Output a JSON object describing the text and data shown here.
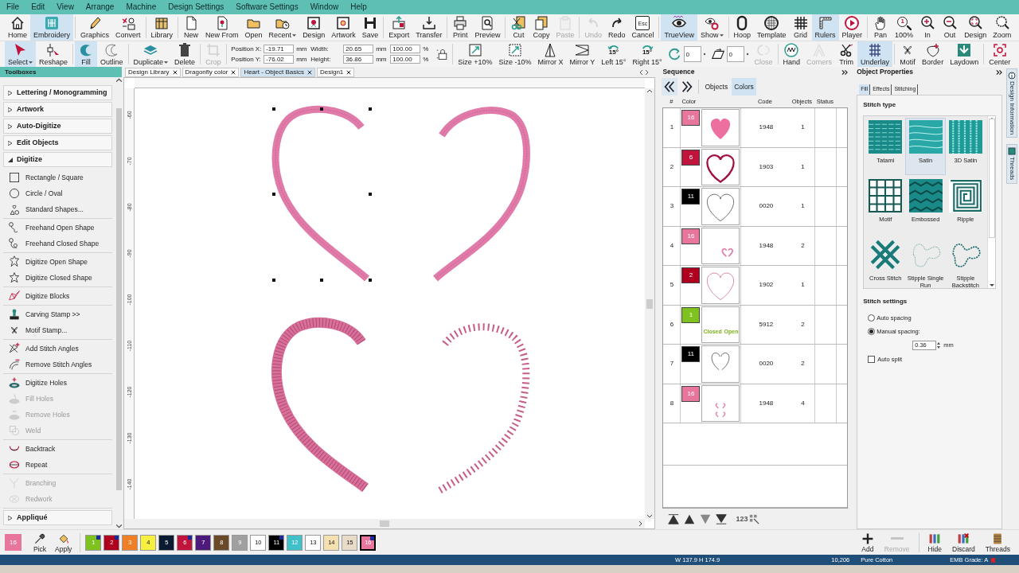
{
  "menu": [
    "File",
    "Edit",
    "View",
    "Arrange",
    "Machine",
    "Design Settings",
    "Software Settings",
    "Window",
    "Help"
  ],
  "ribbon": [
    {
      "label": "Home",
      "selected": false,
      "disabled": false
    },
    {
      "label": "Embroidery",
      "selected": true,
      "disabled": false,
      "group_end": true
    },
    {
      "label": "Graphics",
      "selected": false,
      "disabled": false
    },
    {
      "label": "Convert",
      "selected": false,
      "disabled": false,
      "group_end": true
    },
    {
      "label": "Library",
      "selected": false,
      "disabled": false,
      "group_end": true
    },
    {
      "label": "New",
      "selected": false,
      "disabled": false
    },
    {
      "label": "New From",
      "selected": false,
      "disabled": false
    },
    {
      "label": "Open",
      "selected": false,
      "disabled": false
    },
    {
      "label": "Recent",
      "selected": false,
      "disabled": false,
      "dropdown": true
    },
    {
      "label": "Design",
      "selected": false,
      "disabled": false
    },
    {
      "label": "Artwork",
      "selected": false,
      "disabled": false
    },
    {
      "label": "Save",
      "selected": false,
      "disabled": false,
      "group_end": true
    },
    {
      "label": "Export",
      "selected": false,
      "disabled": false
    },
    {
      "label": "Transfer",
      "selected": false,
      "disabled": false,
      "group_end": true
    },
    {
      "label": "Print",
      "selected": false,
      "disabled": false
    },
    {
      "label": "Preview",
      "selected": false,
      "disabled": false,
      "group_end": true
    },
    {
      "label": "Cut",
      "selected": false,
      "disabled": false
    },
    {
      "label": "Copy",
      "selected": false,
      "disabled": false
    },
    {
      "label": "Paste",
      "selected": false,
      "disabled": true,
      "group_end": true
    },
    {
      "label": "Undo",
      "selected": false,
      "disabled": true
    },
    {
      "label": "Redo",
      "selected": false,
      "disabled": false
    },
    {
      "label": "Cancel",
      "selected": false,
      "disabled": false,
      "icon_text": "Esc",
      "group_end": true
    },
    {
      "label": "TrueView",
      "selected": true,
      "disabled": false
    },
    {
      "label": "Show",
      "selected": false,
      "disabled": false,
      "dropdown": true,
      "group_end": true
    },
    {
      "label": "Hoop",
      "selected": false,
      "disabled": false
    },
    {
      "label": "Template",
      "selected": false,
      "disabled": false
    },
    {
      "label": "Grid",
      "selected": false,
      "disabled": false
    },
    {
      "label": "Rulers",
      "selected": true,
      "disabled": false
    },
    {
      "label": "Player",
      "selected": false,
      "disabled": false,
      "group_end": true
    },
    {
      "label": "Pan",
      "selected": false,
      "disabled": false
    },
    {
      "label": "100%",
      "selected": false,
      "disabled": false,
      "icon_text": "1"
    },
    {
      "label": "In",
      "selected": false,
      "disabled": false
    },
    {
      "label": "Out",
      "selected": false,
      "disabled": false
    },
    {
      "label": "Design",
      "selected": false,
      "disabled": false
    },
    {
      "label": "Zoom",
      "selected": false,
      "disabled": false
    }
  ],
  "toolbar": [
    {
      "kind": "button",
      "label": "Select",
      "selected": true,
      "disabled": false,
      "dropdown": true
    },
    {
      "kind": "button",
      "label": "Reshape",
      "selected": false,
      "disabled": false,
      "group_end": true
    },
    {
      "kind": "button",
      "label": "Fill",
      "selected": true,
      "disabled": false
    },
    {
      "kind": "button",
      "label": "Outline",
      "selected": false,
      "disabled": false,
      "group_end": true
    },
    {
      "kind": "button",
      "label": "Duplicate",
      "selected": false,
      "disabled": false,
      "dropdown": true
    },
    {
      "kind": "button",
      "label": "Delete",
      "selected": false,
      "disabled": false,
      "group_end": true
    },
    {
      "kind": "button",
      "label": "Crop",
      "selected": false,
      "disabled": true,
      "group_end": true
    },
    {
      "kind": "fields",
      "fields": [
        {
          "label": "Position X:",
          "value": "-19.71",
          "unit": "mm"
        },
        {
          "label": "Position Y:",
          "value": "-76.02",
          "unit": "mm"
        }
      ]
    },
    {
      "kind": "fields",
      "fields": [
        {
          "label": "Width:",
          "value": "20.65",
          "unit": "mm"
        },
        {
          "label": "Height:",
          "value": "36.86",
          "unit": "mm"
        }
      ]
    },
    {
      "kind": "fields",
      "fields": [
        {
          "value": "100.00",
          "unit": "%"
        },
        {
          "value": "100.00",
          "unit": "%"
        }
      ]
    },
    {
      "kind": "lock",
      "group_end": true
    },
    {
      "kind": "button",
      "label": "Size +10%",
      "selected": false,
      "disabled": false
    },
    {
      "kind": "button",
      "label": "Size -10%",
      "selected": false,
      "disabled": false
    },
    {
      "kind": "button",
      "label": "Mirror X",
      "selected": false,
      "disabled": false
    },
    {
      "kind": "button",
      "label": "Mirror Y",
      "selected": false,
      "disabled": false
    },
    {
      "kind": "button",
      "label": "Left 15°",
      "selected": false,
      "disabled": false,
      "icon_text": "15°"
    },
    {
      "kind": "button",
      "label": "Right 15°",
      "selected": false,
      "disabled": false,
      "icon_text": "15°"
    },
    {
      "kind": "spin",
      "value": "0"
    },
    {
      "kind": "spin",
      "value": "0"
    },
    {
      "kind": "button",
      "label": "Close",
      "selected": false,
      "disabled": true,
      "group_end": true
    },
    {
      "kind": "button",
      "label": "Hand",
      "selected": false,
      "disabled": false
    },
    {
      "kind": "button",
      "label": "Corners",
      "selected": false,
      "disabled": true
    },
    {
      "kind": "button",
      "label": "Trim",
      "selected": false,
      "disabled": false
    },
    {
      "kind": "button",
      "label": "Underlay",
      "selected": true,
      "disabled": false,
      "group_end": true
    },
    {
      "kind": "button",
      "label": "Motif",
      "selected": false,
      "disabled": false
    },
    {
      "kind": "button",
      "label": "Border",
      "selected": false,
      "disabled": false
    },
    {
      "kind": "button",
      "label": "Laydown",
      "selected": false,
      "disabled": false,
      "group_end": true
    },
    {
      "kind": "button",
      "label": "Center",
      "selected": false,
      "disabled": false
    }
  ],
  "toolboxes": {
    "title": "Toolboxes",
    "sections": [
      {
        "label": "Lettering / Monogramming",
        "expanded": false
      },
      {
        "label": "Artwork",
        "expanded": false
      },
      {
        "label": "Auto-Digitize",
        "expanded": false
      },
      {
        "label": "Edit Objects",
        "expanded": false
      },
      {
        "label": "Digitize",
        "expanded": true,
        "groups": [
          [
            {
              "label": "Rectangle / Square",
              "disabled": false
            },
            {
              "label": "Circle / Oval",
              "disabled": false
            },
            {
              "label": "Standard Shapes...",
              "disabled": false
            }
          ],
          [
            {
              "label": "Freehand Open Shape",
              "disabled": false
            },
            {
              "label": "Freehand Closed Shape",
              "disabled": false
            }
          ],
          [
            {
              "label": "Digitize Open Shape",
              "disabled": false
            },
            {
              "label": "Digitize Closed Shape",
              "disabled": false
            }
          ],
          [
            {
              "label": "Digitize Blocks",
              "disabled": false
            }
          ],
          [
            {
              "label": "Carving Stamp >>",
              "disabled": false
            },
            {
              "label": "Motif Stamp...",
              "disabled": false
            }
          ],
          [
            {
              "label": "Add Stitch Angles",
              "disabled": false
            },
            {
              "label": "Remove Stitch Angles",
              "disabled": false
            }
          ],
          [
            {
              "label": "Digitize Holes",
              "disabled": false
            },
            {
              "label": "Fill Holes",
              "disabled": true
            },
            {
              "label": "Remove Holes",
              "disabled": true
            },
            {
              "label": "Weld",
              "disabled": true
            }
          ],
          [
            {
              "label": "Backtrack",
              "disabled": false
            },
            {
              "label": "Repeat",
              "disabled": false
            }
          ],
          [
            {
              "label": "Branching",
              "disabled": true
            },
            {
              "label": "Redwork",
              "disabled": true
            }
          ]
        ]
      },
      {
        "label": "Appliqué",
        "expanded": false
      }
    ]
  },
  "doc_tabs": [
    {
      "label": "Design Library",
      "selected": false
    },
    {
      "label": "Dragonfly color",
      "selected": false
    },
    {
      "label": "Heart - Object Basics",
      "selected": true
    },
    {
      "label": "Design1",
      "selected": false
    }
  ],
  "canvas": {
    "ruler_labels": [
      "-60",
      "-70",
      "-80",
      "-90",
      "-100",
      "-110",
      "-120",
      "-130",
      "-140"
    ]
  },
  "sequence": {
    "title": "Sequence",
    "tabs": [
      {
        "label": "Objects",
        "selected": false
      },
      {
        "label": "Colors",
        "selected": true
      }
    ],
    "columns": [
      "#",
      "Color",
      "Code",
      "Objects",
      "Status"
    ],
    "rows": [
      {
        "number": "1",
        "swatch": "16",
        "color": "#e8759c",
        "code": "1948",
        "objects": "1"
      },
      {
        "number": "2",
        "swatch": "6",
        "color": "#c0143c",
        "code": "1903",
        "objects": "1"
      },
      {
        "number": "3",
        "swatch": "11",
        "color": "#000000",
        "code": "0020",
        "objects": "1"
      },
      {
        "number": "4",
        "swatch": "16",
        "color": "#e8759c",
        "code": "1948",
        "objects": "2"
      },
      {
        "number": "5",
        "swatch": "2",
        "color": "#b00020",
        "code": "1902",
        "objects": "1"
      },
      {
        "number": "6",
        "swatch": "1",
        "color": "#7dc21e",
        "code": "5912",
        "objects": "2",
        "thumb_labels": [
          "Closed",
          "Open"
        ]
      },
      {
        "number": "7",
        "swatch": "11",
        "color": "#000000",
        "code": "0020",
        "objects": "2"
      },
      {
        "number": "8",
        "swatch": "16",
        "color": "#e8759c",
        "code": "1948",
        "objects": "4"
      }
    ],
    "order_label": "123"
  },
  "properties": {
    "title": "Object Properties",
    "tabs": [
      {
        "label": "Fill",
        "selected": true
      },
      {
        "label": "Effects",
        "selected": false
      },
      {
        "label": "Stitching",
        "selected": false
      }
    ],
    "stitch_type_title": "Stitch type",
    "stitch_types": [
      {
        "label": "Tatami",
        "selected": false
      },
      {
        "label": "Satin",
        "selected": true
      },
      {
        "label": "3D Satin",
        "selected": false
      },
      {
        "label": "Motif",
        "selected": false
      },
      {
        "label": "Embossed",
        "selected": false
      },
      {
        "label": "Ripple",
        "selected": false
      },
      {
        "label": "Cross Stitch",
        "selected": false
      },
      {
        "label": "Stipple Single Run",
        "selected": false
      },
      {
        "label": "Stipple Backstitch",
        "selected": false
      }
    ],
    "settings_title": "Stitch settings",
    "spacing": [
      {
        "label": "Auto spacing",
        "selected": false
      },
      {
        "label": "Manual spacing:",
        "selected": true
      }
    ],
    "spacing_value": "0.36",
    "spacing_unit": "mm",
    "auto_split": {
      "label": "Auto split",
      "checked": false
    }
  },
  "side_tabs": [
    "Design Information",
    "Threads"
  ],
  "palette": {
    "current": {
      "number": "16",
      "color": "#e8759c"
    },
    "tools": [
      "Pick",
      "Apply"
    ],
    "swatches": [
      {
        "number": "1",
        "color": "#7dc21e",
        "used": true,
        "selected": false
      },
      {
        "number": "2",
        "color": "#b00020",
        "used": true,
        "selected": false
      },
      {
        "number": "3",
        "color": "#f08028",
        "used": false,
        "selected": false
      },
      {
        "number": "4",
        "color": "#f8f040",
        "used": false,
        "selected": false
      },
      {
        "number": "5",
        "color": "#0a1a30",
        "used": false,
        "selected": false
      },
      {
        "number": "6",
        "color": "#c0143c",
        "used": true,
        "selected": false
      },
      {
        "number": "7",
        "color": "#4b1a7a",
        "used": false,
        "selected": false
      },
      {
        "number": "8",
        "color": "#6b4a2a",
        "used": false,
        "selected": false
      },
      {
        "number": "9",
        "color": "#a0a0a0",
        "used": false,
        "selected": false
      },
      {
        "number": "10",
        "color": "#ffffff",
        "used": false,
        "selected": false
      },
      {
        "number": "11",
        "color": "#000000",
        "used": true,
        "selected": false
      },
      {
        "number": "12",
        "color": "#40c0c8",
        "used": false,
        "selected": false
      },
      {
        "number": "13",
        "color": "#ffffff",
        "used": false,
        "selected": false
      },
      {
        "number": "14",
        "color": "#f5e0b0",
        "used": false,
        "selected": false
      },
      {
        "number": "15",
        "color": "#e8dcc8",
        "used": false,
        "selected": false
      },
      {
        "number": "16",
        "color": "#e8759c",
        "used": true,
        "selected": true
      }
    ],
    "actions": [
      {
        "label": "Add",
        "disabled": false
      },
      {
        "label": "Remove",
        "disabled": true
      },
      {
        "label": "Hide",
        "disabled": false
      },
      {
        "label": "Discard",
        "disabled": false
      },
      {
        "label": "Threads",
        "disabled": false
      }
    ]
  },
  "status_bar": {
    "size": "W 137.9 H 174.9",
    "stitches": "10,206",
    "thread": "Pure Cotton",
    "grade": "EMB Grade: A"
  }
}
